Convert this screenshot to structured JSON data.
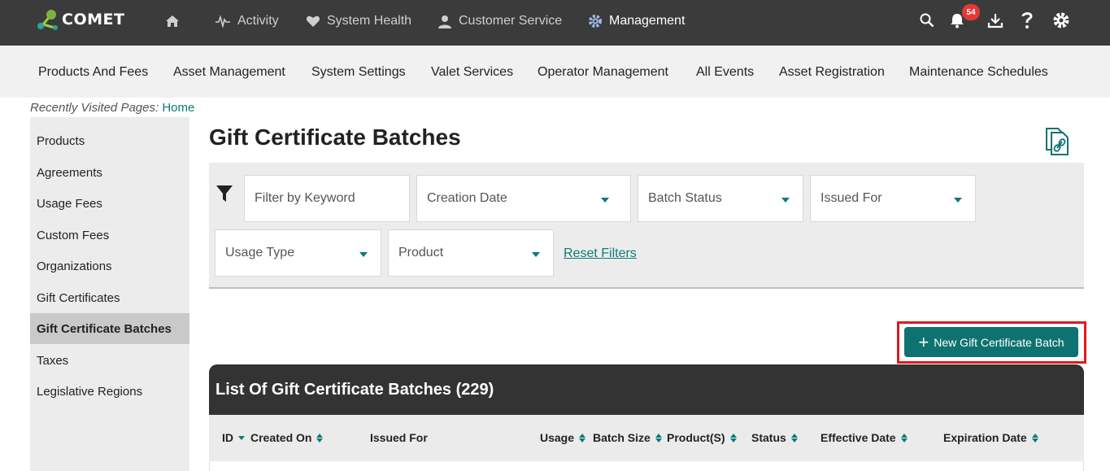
{
  "app": {
    "name": "COMET"
  },
  "topnav": {
    "items": [
      {
        "label": "",
        "icon": "home-icon"
      },
      {
        "label": "Activity",
        "icon": "activity-icon"
      },
      {
        "label": "System Health",
        "icon": "heart-icon"
      },
      {
        "label": "Customer Service",
        "icon": "user-icon"
      },
      {
        "label": "Management",
        "icon": "gear-icon",
        "active": true
      }
    ],
    "notifications_count": "54"
  },
  "subnav": {
    "items": [
      "Products And Fees",
      "Asset Management",
      "System Settings",
      "Valet Services",
      "Operator Management",
      "All Events",
      "Asset Registration",
      "Maintenance Schedules"
    ]
  },
  "recent": {
    "label": "Recently Visited Pages:",
    "link": "Home"
  },
  "sidebar": {
    "items": [
      {
        "label": "Products"
      },
      {
        "label": "Agreements"
      },
      {
        "label": "Usage Fees"
      },
      {
        "label": "Custom Fees"
      },
      {
        "label": "Organizations"
      },
      {
        "label": "Gift Certificates"
      },
      {
        "label": "Gift Certificate Batches",
        "active": true
      },
      {
        "label": "Taxes"
      },
      {
        "label": "Legislative Regions"
      }
    ]
  },
  "page": {
    "title": "Gift Certificate Batches"
  },
  "filters": {
    "keyword_placeholder": "Filter by Keyword",
    "creation_date": "Creation Date",
    "batch_status": "Batch Status",
    "issued_for": "Issued For",
    "usage_type": "Usage Type",
    "product": "Product",
    "reset_label": "Reset Filters"
  },
  "actions": {
    "new_batch": "New Gift Certificate Batch"
  },
  "list": {
    "title": "List Of Gift Certificate Batches (229)",
    "columns": [
      "ID",
      "Created On",
      "Issued For",
      "Usage",
      "Batch Size",
      "Product(S)",
      "Status",
      "Effective Date",
      "Expiration Date"
    ]
  },
  "colors": {
    "accent": "#0e7370",
    "topbar": "#3b3b3b",
    "highlight": "#e0191b",
    "badge": "#e53935"
  }
}
